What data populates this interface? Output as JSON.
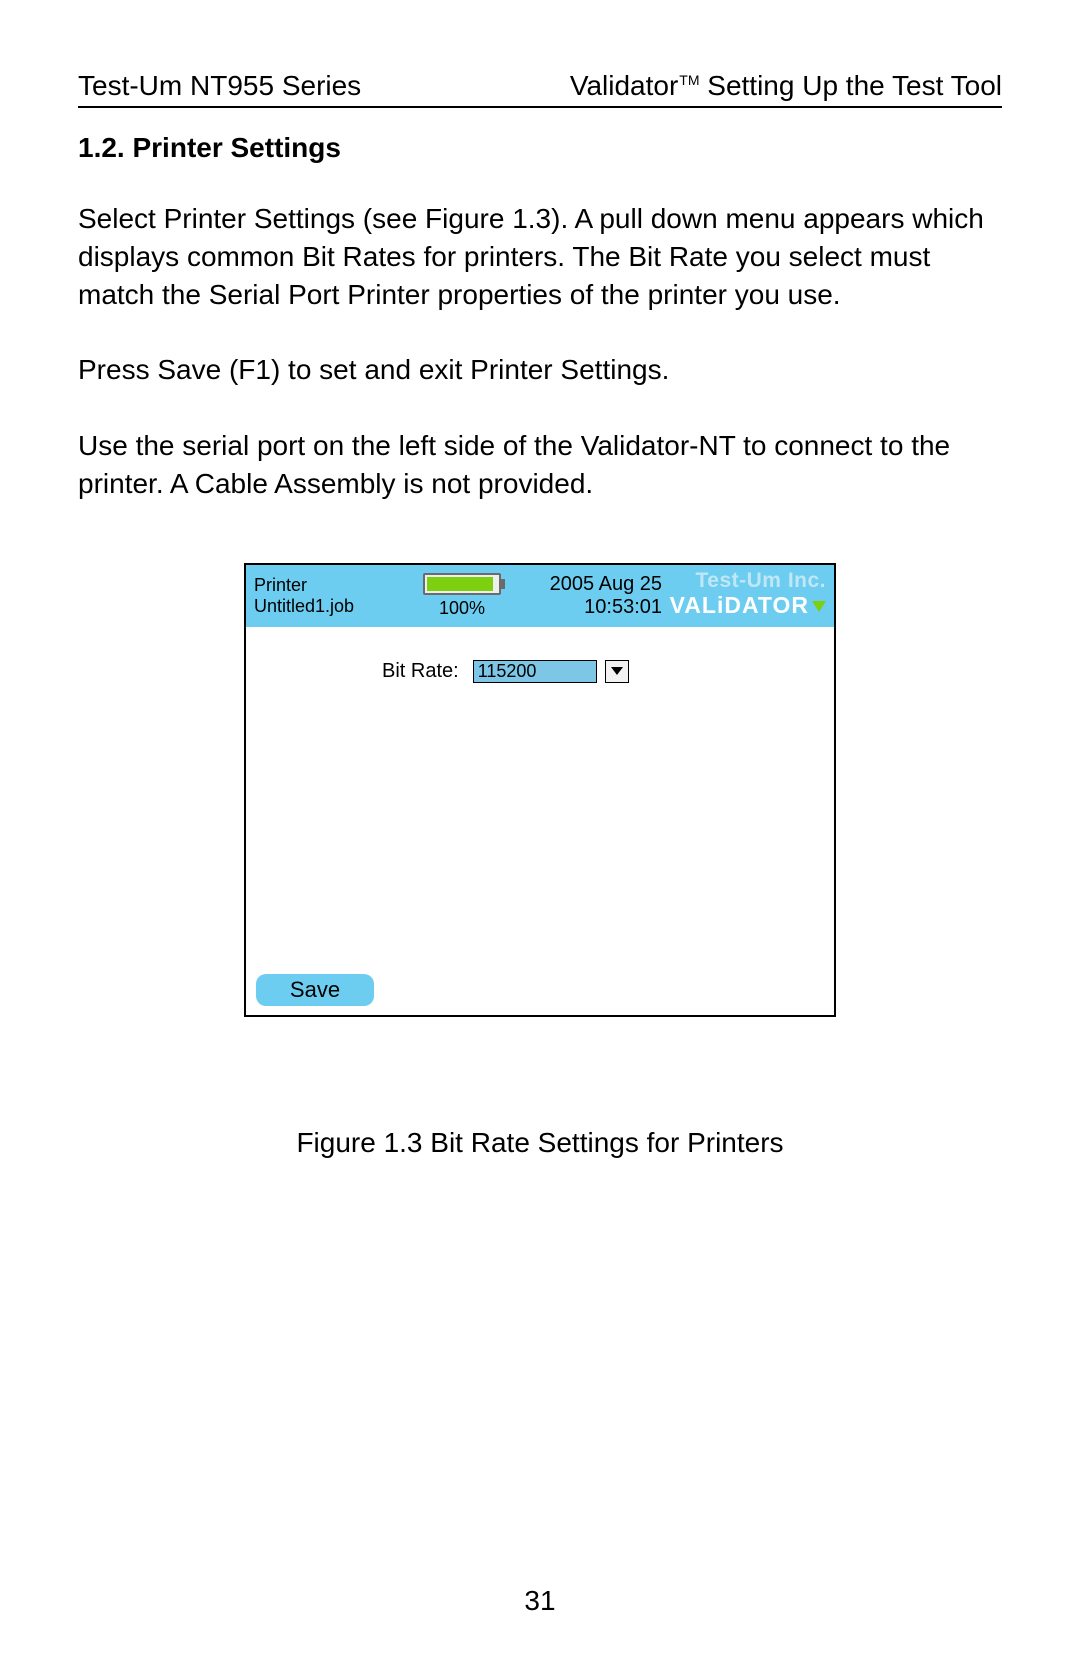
{
  "header": {
    "left": "Test-Um NT955 Series",
    "right_prefix": "Validator",
    "right_tm": "TM",
    "right_suffix": " Setting Up the Test Tool"
  },
  "section": {
    "title": "1.2. Printer Settings"
  },
  "paragraphs": {
    "p1": "Select Printer Settings (see Figure 1.3).  A pull down menu appears which displays common Bit Rates for printers. The Bit Rate you select must match the Serial Port Printer properties of the printer you use.",
    "p2": "Press Save (F1) to set and exit Printer Settings.",
    "p3": "Use the serial port on the left side of the Validator-NT to connect to the printer.  A Cable Assembly is not provided."
  },
  "screenshot": {
    "header": {
      "title": "Printer",
      "job_file": "Untitled1.job",
      "battery_percent": "100%",
      "date": "2005 Aug 25",
      "time": "10:53:01",
      "brand_top": "Test-Um Inc.",
      "brand_bottom": "VALiDATOR"
    },
    "bitrate": {
      "label": "Bit Rate:",
      "value": "115200"
    },
    "save_label": "Save"
  },
  "figure_caption": "Figure 1.3 Bit Rate Settings for Printers",
  "page_number": "31"
}
